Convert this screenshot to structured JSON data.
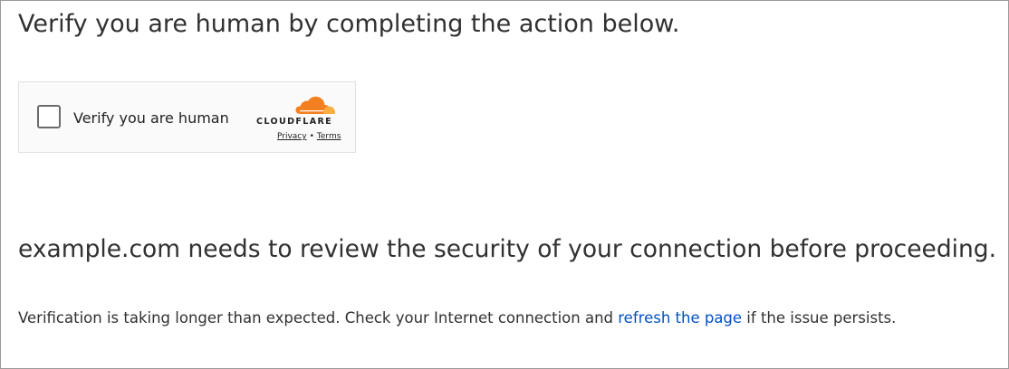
{
  "heading": "Verify you are human by completing the action below.",
  "widget": {
    "checkbox_label": "Verify you are human",
    "checked": false,
    "brand_name": "CLOUDFLARE",
    "privacy_label": "Privacy",
    "separator": "•",
    "terms_label": "Terms"
  },
  "subheading": "example.com needs to review the security of your connection before proceeding.",
  "note": {
    "before_link": "Verification is taking longer than expected. Check your Internet connection and ",
    "link_text": "refresh the page",
    "after_link": " if the issue persists."
  },
  "colors": {
    "link": "#0051c3",
    "cloud_orange": "#f38020",
    "cloud_light_orange": "#faae40",
    "text": "#313131"
  }
}
